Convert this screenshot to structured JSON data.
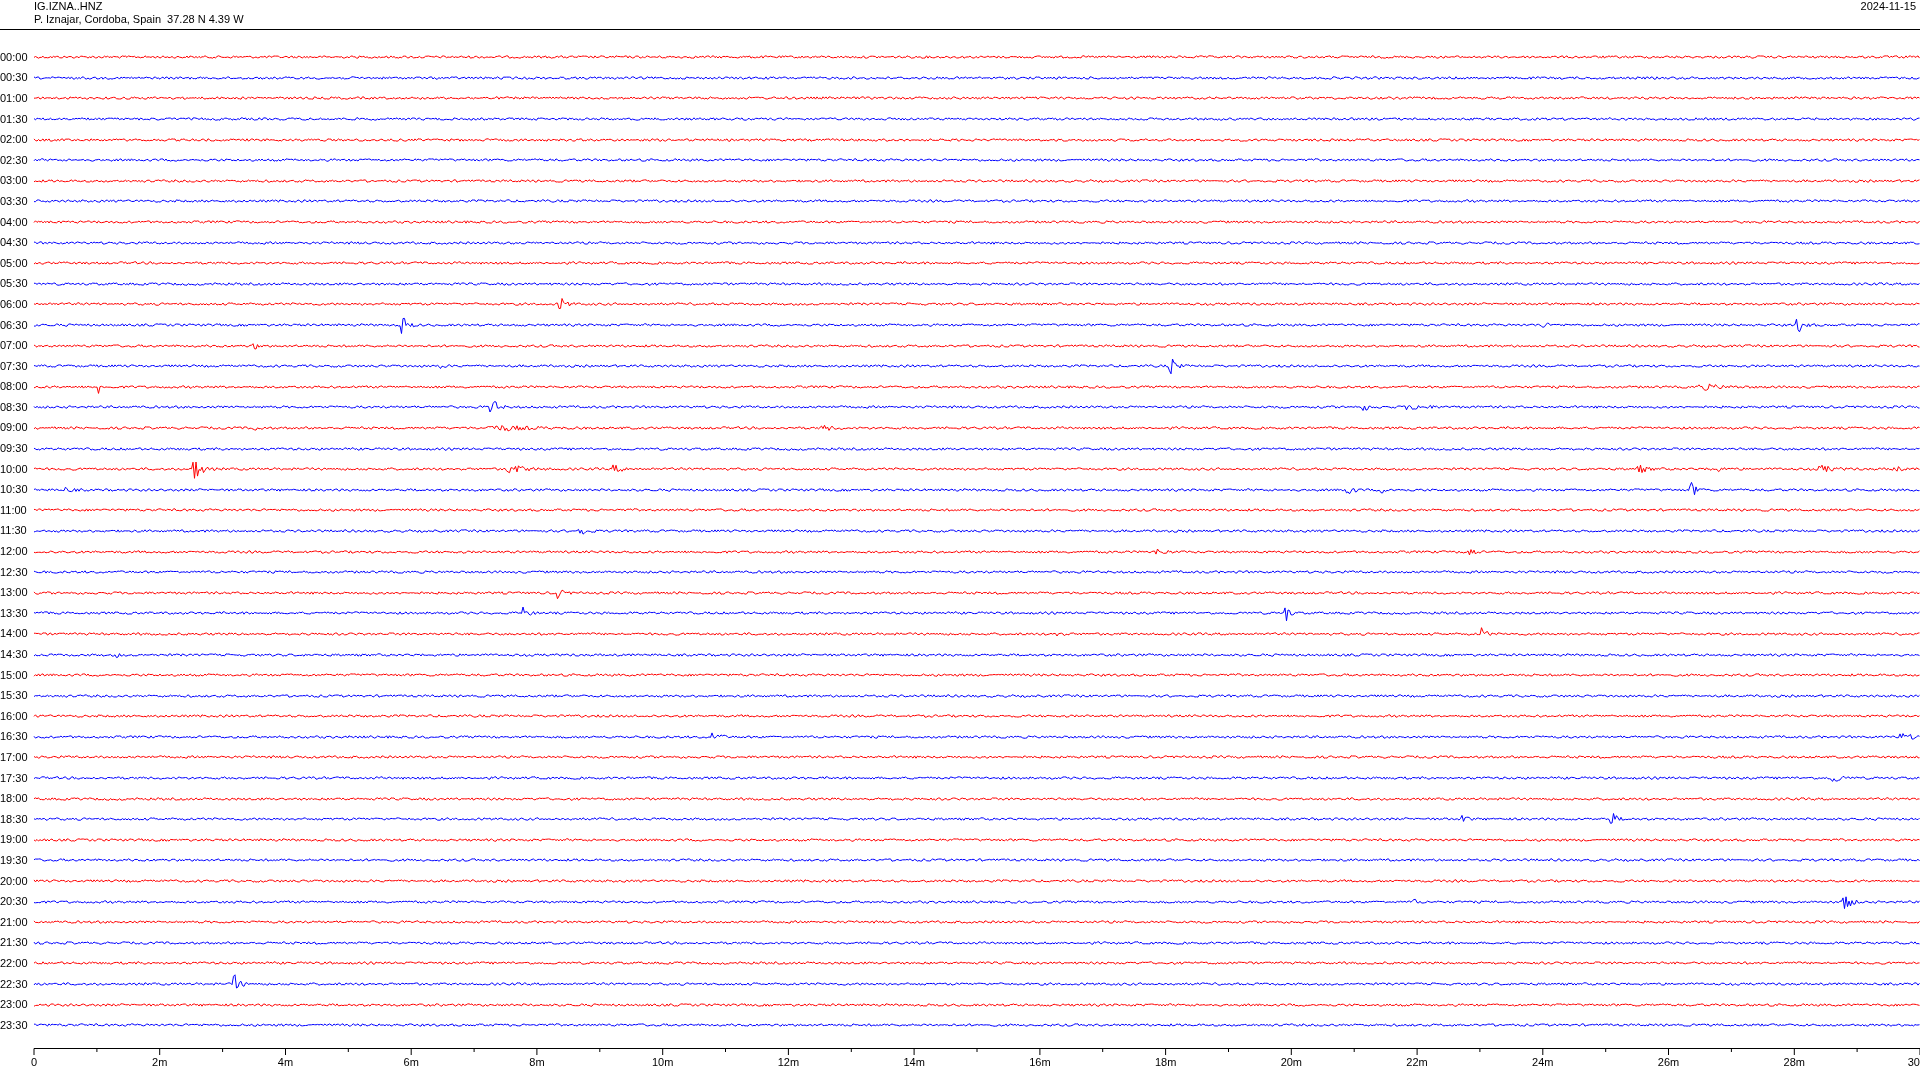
{
  "header": {
    "station": "IG.IZNA..HNZ",
    "location": "P. Iznajar, Cordoba, Spain  37.28 N 4.39 W",
    "date": "2024-11-15"
  },
  "traces": [
    {
      "label": "00:00",
      "color": "#ff0000"
    },
    {
      "label": "00:30",
      "color": "#0000ff"
    },
    {
      "label": "01:00",
      "color": "#ff0000"
    },
    {
      "label": "01:30",
      "color": "#0000ff"
    },
    {
      "label": "02:00",
      "color": "#ff0000"
    },
    {
      "label": "02:30",
      "color": "#0000ff"
    },
    {
      "label": "03:00",
      "color": "#ff0000"
    },
    {
      "label": "03:30",
      "color": "#0000ff"
    },
    {
      "label": "04:00",
      "color": "#ff0000"
    },
    {
      "label": "04:30",
      "color": "#0000ff"
    },
    {
      "label": "05:00",
      "color": "#ff0000"
    },
    {
      "label": "05:30",
      "color": "#0000ff"
    },
    {
      "label": "06:00",
      "color": "#ff0000"
    },
    {
      "label": "06:30",
      "color": "#0000ff"
    },
    {
      "label": "07:00",
      "color": "#ff0000"
    },
    {
      "label": "07:30",
      "color": "#0000ff"
    },
    {
      "label": "08:00",
      "color": "#ff0000"
    },
    {
      "label": "08:30",
      "color": "#0000ff"
    },
    {
      "label": "09:00",
      "color": "#ff0000"
    },
    {
      "label": "09:30",
      "color": "#0000ff"
    },
    {
      "label": "10:00",
      "color": "#ff0000"
    },
    {
      "label": "10:30",
      "color": "#0000ff"
    },
    {
      "label": "11:00",
      "color": "#ff0000"
    },
    {
      "label": "11:30",
      "color": "#0000ff"
    },
    {
      "label": "12:00",
      "color": "#ff0000"
    },
    {
      "label": "12:30",
      "color": "#0000ff"
    },
    {
      "label": "13:00",
      "color": "#ff0000"
    },
    {
      "label": "13:30",
      "color": "#0000ff"
    },
    {
      "label": "14:00",
      "color": "#ff0000"
    },
    {
      "label": "14:30",
      "color": "#0000ff"
    },
    {
      "label": "15:00",
      "color": "#ff0000"
    },
    {
      "label": "15:30",
      "color": "#0000ff"
    },
    {
      "label": "16:00",
      "color": "#ff0000"
    },
    {
      "label": "16:30",
      "color": "#0000ff"
    },
    {
      "label": "17:00",
      "color": "#ff0000"
    },
    {
      "label": "17:30",
      "color": "#0000ff"
    },
    {
      "label": "18:00",
      "color": "#ff0000"
    },
    {
      "label": "18:30",
      "color": "#0000ff"
    },
    {
      "label": "19:00",
      "color": "#ff0000"
    },
    {
      "label": "19:30",
      "color": "#0000ff"
    },
    {
      "label": "20:00",
      "color": "#ff0000"
    },
    {
      "label": "20:30",
      "color": "#0000ff"
    },
    {
      "label": "21:00",
      "color": "#ff0000"
    },
    {
      "label": "21:30",
      "color": "#0000ff"
    },
    {
      "label": "22:00",
      "color": "#ff0000"
    },
    {
      "label": "22:30",
      "color": "#0000ff"
    },
    {
      "label": "23:00",
      "color": "#ff0000"
    },
    {
      "label": "23:30",
      "color": "#0000ff"
    }
  ],
  "x_axis": {
    "tick_labels": [
      "0",
      "2m",
      "4m",
      "6m",
      "8m",
      "10m",
      "12m",
      "14m",
      "16m",
      "18m",
      "20m",
      "22m",
      "24m",
      "26m",
      "28m",
      "30"
    ]
  }
}
